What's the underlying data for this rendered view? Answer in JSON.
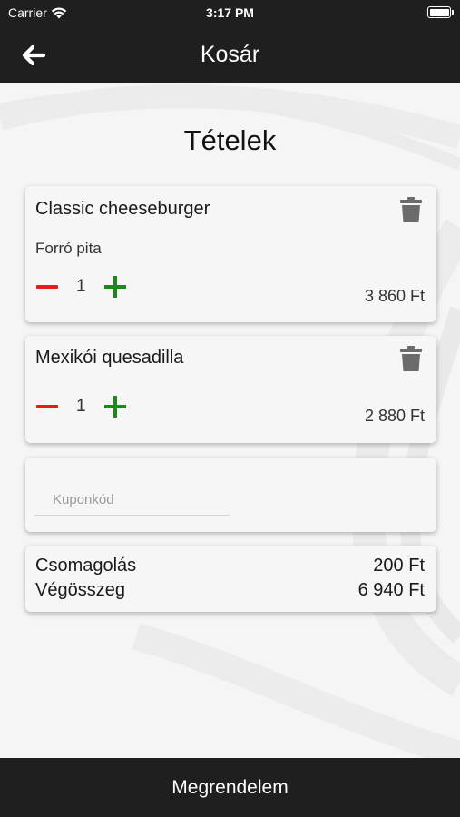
{
  "status_bar": {
    "carrier": "Carrier",
    "time": "3:17 PM"
  },
  "nav": {
    "title": "Kosár",
    "back_icon": "arrow-left-icon"
  },
  "section_title": "Tételek",
  "items": [
    {
      "name": "Classic cheeseburger",
      "option": "Forró pita",
      "quantity": "1",
      "price": "3 860 Ft"
    },
    {
      "name": "Mexikói quesadilla",
      "quantity": "1",
      "price": "2 880 Ft"
    }
  ],
  "coupon": {
    "placeholder": "Kuponkód",
    "value": ""
  },
  "summary": {
    "packaging_label": "Csomagolás",
    "packaging_value": "200 Ft",
    "total_label": "Végösszeg",
    "total_value": "6 940 Ft"
  },
  "order_button": "Megrendelem",
  "colors": {
    "bar_background": "#1f1f1f",
    "minus": "#e41c1c",
    "plus": "#1b8a1b",
    "trash": "#6b6b6b"
  }
}
